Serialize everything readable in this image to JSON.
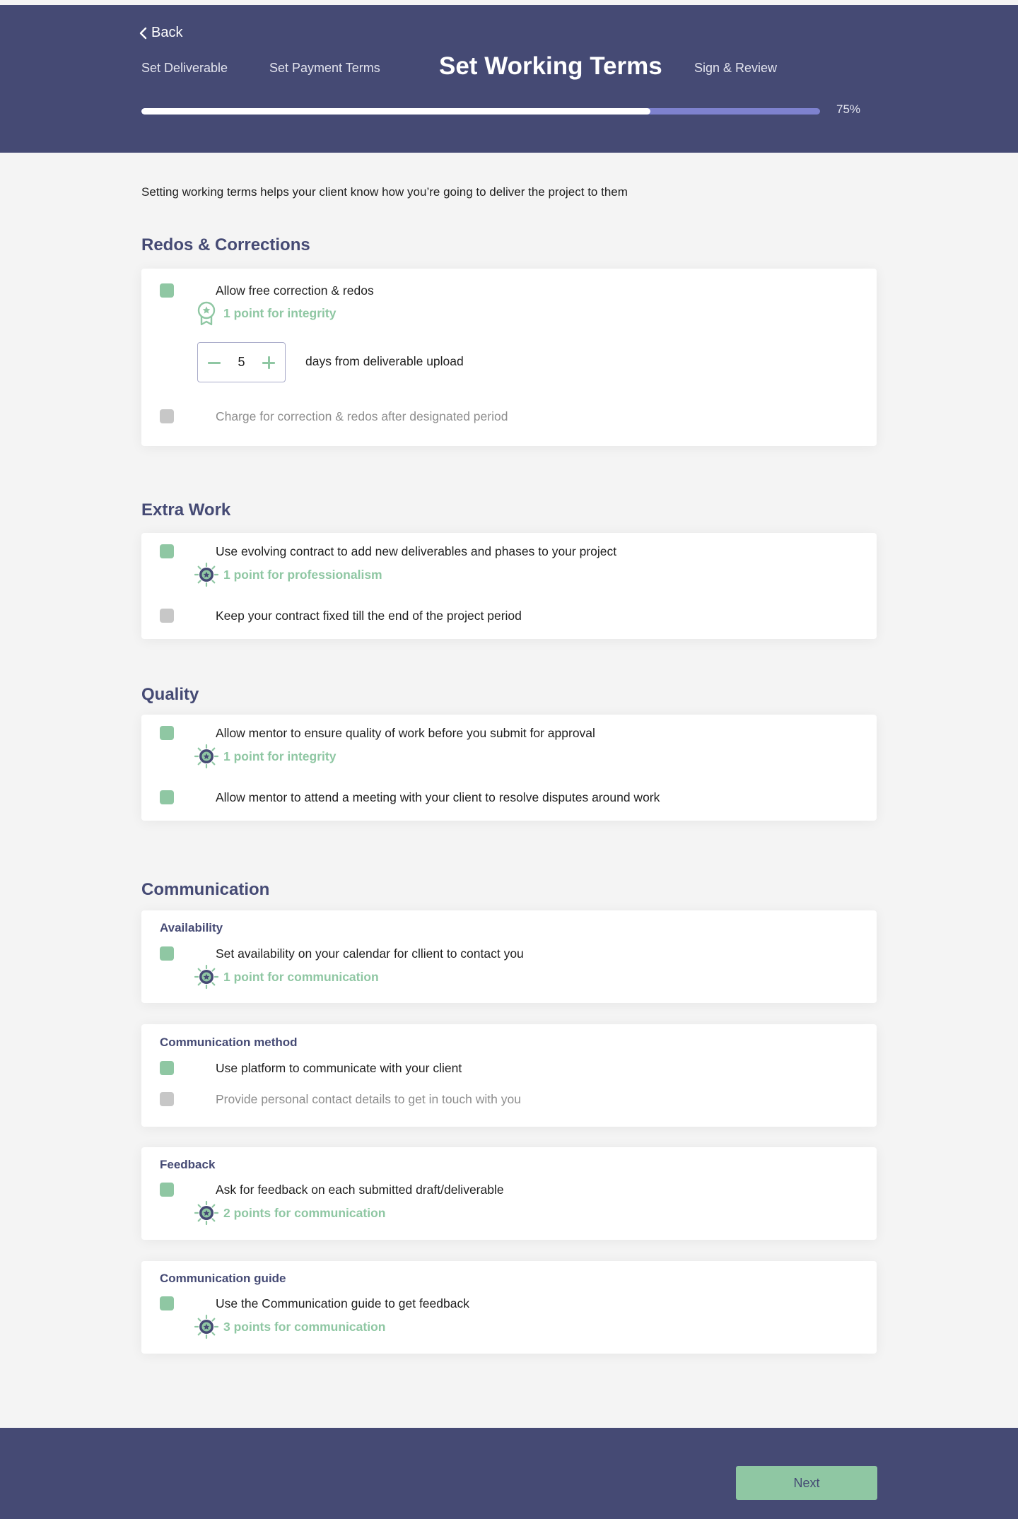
{
  "header": {
    "back_label": "Back",
    "steps": [
      "Set Deliverable",
      "Set Payment Terms",
      "Set Working Terms",
      "Sign & Review"
    ],
    "current_step": "Set Working Terms",
    "progress": 0.75,
    "progress_label": "75%"
  },
  "intro": "Setting working terms helps your client know how you’re going to deliver the project to them",
  "redos": {
    "title": "Redos & Corrections",
    "options": [
      {
        "label": "Allow free correction & redos",
        "checked": true,
        "points": "1 point for integrity",
        "points_icon": "ribbon-badge-icon"
      },
      {
        "label": "Charge for correction & redos after designated period",
        "checked": false
      }
    ],
    "stepper_value": "5",
    "stepper_label": "days from deliverable upload"
  },
  "extra_work": {
    "title": "Extra Work",
    "options": [
      {
        "label": "Use evolving contract to add new deliverables and phases to your project",
        "checked": true,
        "points": "1 point for professionalism",
        "points_icon": "sun-badge-icon"
      },
      {
        "label": "Keep your contract fixed till the end of the project period",
        "checked": false
      }
    ]
  },
  "quality": {
    "title": "Quality",
    "options": [
      {
        "label": "Allow mentor to ensure quality of work before you submit for approval",
        "checked": true,
        "points": "1 point for integrity",
        "points_icon": "sun-badge-icon"
      },
      {
        "label": "Allow mentor to attend a meeting with your client to resolve disputes around work",
        "checked": true
      }
    ]
  },
  "communication": {
    "title": "Communication",
    "availability": {
      "subtitle": "Availability",
      "label": "Set availability on your calendar for cllient to contact you",
      "points": "1 point for communication"
    },
    "method": {
      "subtitle": "Communication method",
      "options": [
        {
          "label": "Use platform to communicate with your client",
          "checked": true
        },
        {
          "label": "Provide personal contact details to get in touch with you",
          "checked": false
        }
      ]
    },
    "feedback": {
      "subtitle": "Feedback",
      "label": "Ask for feedback on each submitted draft/deliverable",
      "points": "2 points for communication"
    },
    "guide": {
      "subtitle": "Communication guide",
      "label": "Use the Communication guide to get feedback",
      "points": "3 points for communication"
    }
  },
  "footer": {
    "next_label": "Next"
  },
  "colors": {
    "brand": "#454a74",
    "accent": "#8fc7a3",
    "progress_track": "#7e82cf",
    "disabled": "#c7c7c7"
  }
}
